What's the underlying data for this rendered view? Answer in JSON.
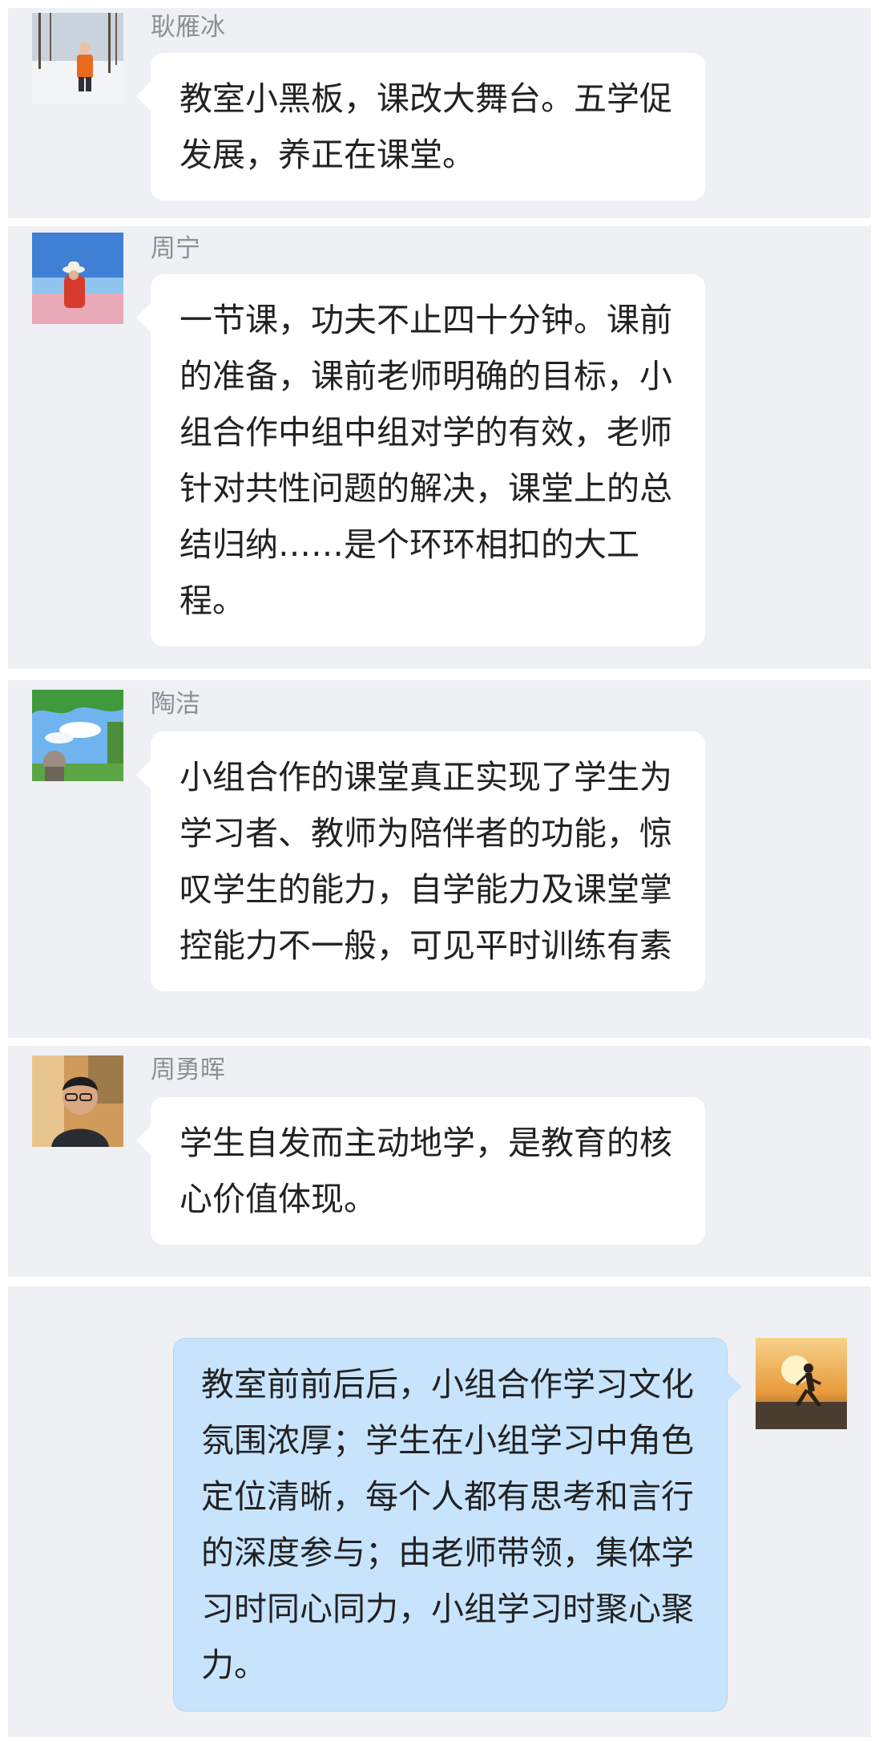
{
  "messages": [
    {
      "name": "耿雁冰",
      "text": "教室小黑板，课改大舞台。五学促发展，养正在课堂。"
    },
    {
      "name": "周宁",
      "text": "一节课，功夫不止四十分钟。课前的准备，课前老师明确的目标，小组合作中组中组对学的有效，老师针对共性问题的解决，课堂上的总结归纳……是个环环相扣的大工程。"
    },
    {
      "name": "陶洁",
      "text": "小组合作的课堂真正实现了学生为学习者、教师为陪伴者的功能，惊叹学生的能力，自学能力及课堂掌控能力不一般，可见平时训练有素"
    },
    {
      "name": "周勇晖",
      "text": "学生自发而主动地学，是教育的核心价值体现。"
    },
    {
      "text": "教室前前后后，小组合作学习文化氛围浓厚；学生在小组学习中角色定位清晰，每个人都有思考和言行的深度参与；由老师带领，集体学习时同心同力，小组学习时聚心聚力。"
    }
  ],
  "avatars": [
    "person-in-snow-avatar",
    "person-with-hat-at-beach-avatar",
    "trees-and-sky-avatar",
    "man-with-glasses-avatar",
    "runner-at-sunset-avatar"
  ],
  "colors": {
    "panel_bg": "#eff0f3",
    "bubble_bg": "#ffffff",
    "self_bubble_bg": "#c8e4fd",
    "name_color": "#8c8f96",
    "text_color": "#222222"
  }
}
